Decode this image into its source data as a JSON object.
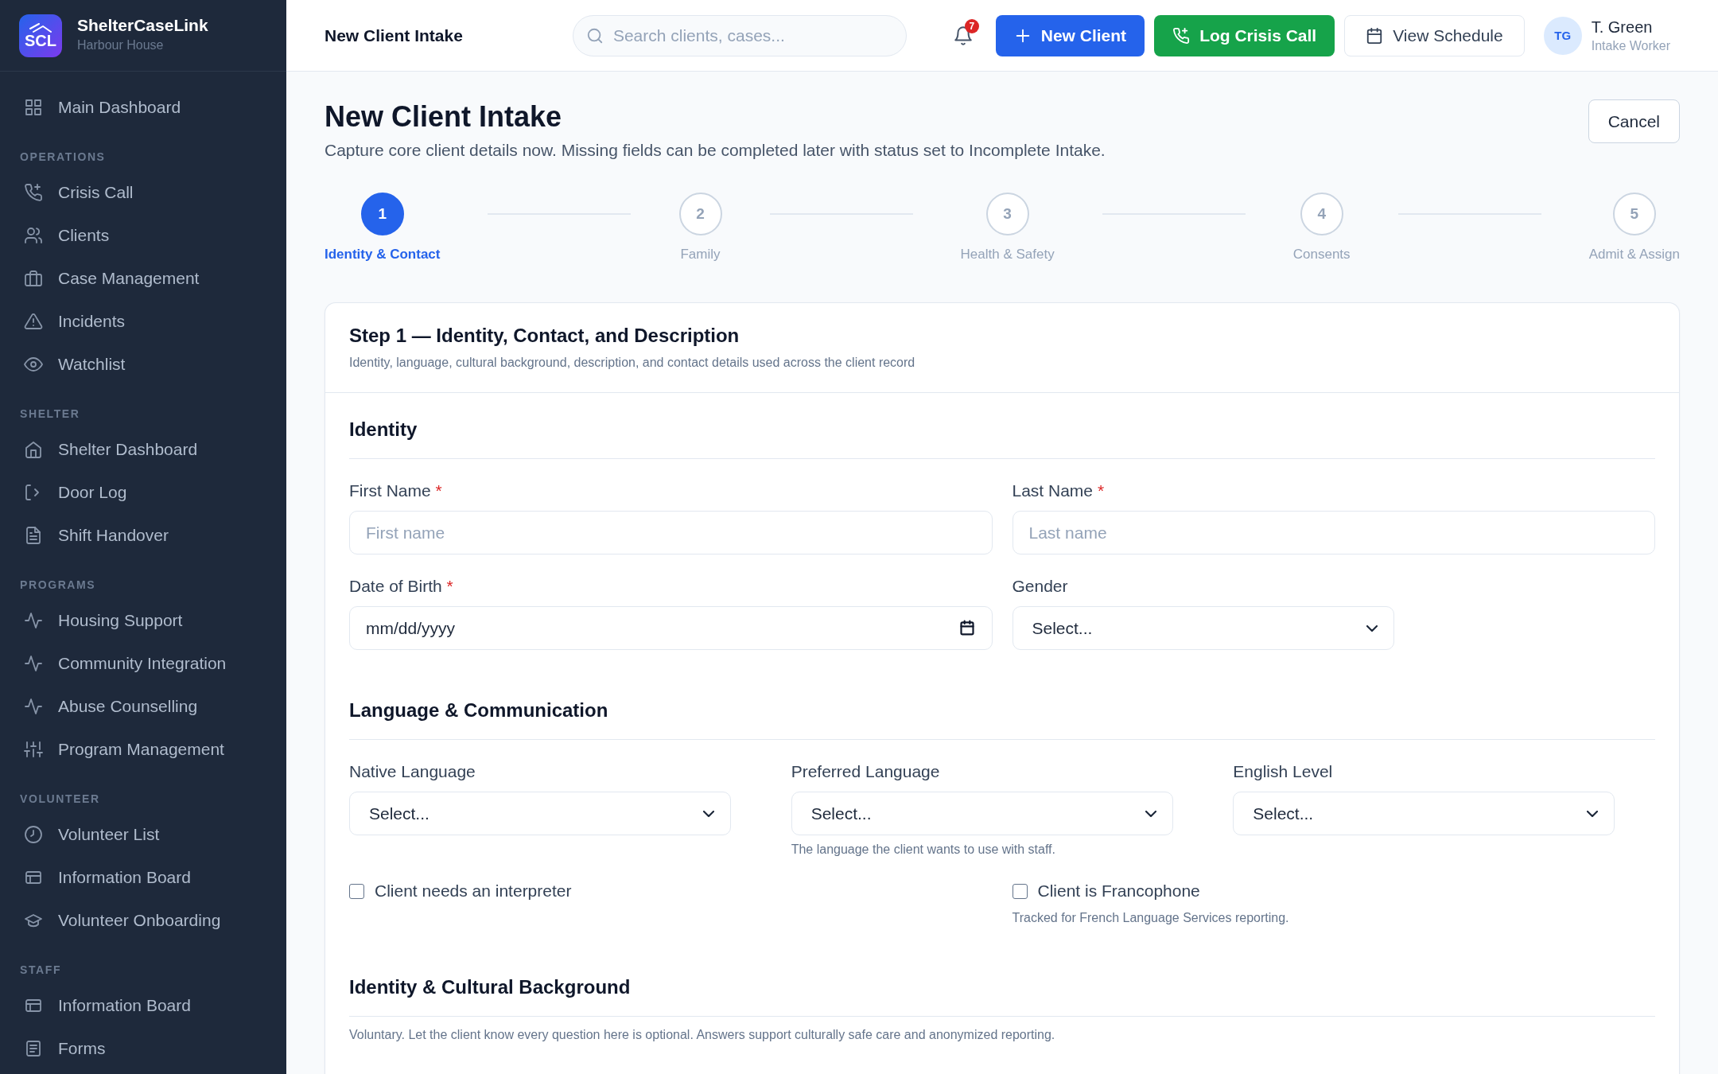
{
  "sidebar": {
    "logo_text": "SCL",
    "app_name": "ShelterCaseLink",
    "subtitle": "Harbour House",
    "sections": [
      {
        "items": [
          {
            "label": "Main Dashboard",
            "selected": false
          }
        ]
      },
      {
        "heading": "OPERATIONS",
        "items": [
          {
            "label": "Crisis Call",
            "selected": false
          },
          {
            "label": "Clients",
            "selected": false
          },
          {
            "label": "Case Management",
            "selected": false
          },
          {
            "label": "Incidents",
            "selected": false
          },
          {
            "label": "Watchlist",
            "selected": false
          }
        ]
      },
      {
        "heading": "SHELTER",
        "items": [
          {
            "label": "Shelter Dashboard",
            "selected": false
          },
          {
            "label": "Door Log",
            "selected": false
          },
          {
            "label": "Shift Handover",
            "selected": false
          }
        ]
      },
      {
        "heading": "PROGRAMS",
        "items": [
          {
            "label": "Housing Support",
            "selected": false
          },
          {
            "label": "Community Integration",
            "selected": false
          },
          {
            "label": "Abuse Counselling",
            "selected": false
          },
          {
            "label": "Program Management",
            "selected": false
          }
        ]
      },
      {
        "heading": "VOLUNTEER",
        "items": [
          {
            "label": "Volunteer List",
            "selected": false
          },
          {
            "label": "Information Board",
            "selected": false
          },
          {
            "label": "Volunteer Onboarding",
            "selected": false
          }
        ]
      },
      {
        "heading": "STAFF",
        "items": [
          {
            "label": "Information Board",
            "selected": false
          },
          {
            "label": "Forms",
            "selected": false
          }
        ]
      }
    ]
  },
  "topbar": {
    "title": "New Client Intake",
    "search": {
      "placeholder": "Search clients, cases..."
    },
    "notification_count": "7",
    "buttons": [
      {
        "label": "New Client",
        "kind": "primary"
      },
      {
        "label": "Log Crisis Call",
        "kind": "success"
      },
      {
        "label": "View Schedule",
        "kind": "secondary"
      }
    ],
    "user": {
      "initials": "TG",
      "name": "T. Green",
      "role": "Intake Worker"
    }
  },
  "page": {
    "title": "New Client Intake",
    "subtitle": "Capture core client details now. Missing fields can be completed later with status set to Incomplete Intake.",
    "cancel_button": "Cancel"
  },
  "steps": [
    {
      "number": "1",
      "label": "Identity & Contact",
      "selected": true
    },
    {
      "number": "2",
      "label": "Family",
      "selected": false
    },
    {
      "number": "3",
      "label": "Health & Safety",
      "selected": false
    },
    {
      "number": "4",
      "label": "Consents",
      "selected": false
    },
    {
      "number": "5",
      "label": "Admit & Assign",
      "selected": false
    }
  ],
  "form_card": {
    "title": "Step 1 — Identity, Contact, and Description",
    "subtitle": "Identity, language, cultural background, description, and contact details used across the client record",
    "sections": [
      {
        "title": "Identity",
        "rows": [
          [
            {
              "kind": "text",
              "label": "First Name",
              "required_mark": "*",
              "placeholder": "First name"
            },
            {
              "kind": "text",
              "label": "Last Name",
              "required_mark": "*",
              "placeholder": "Last name"
            }
          ],
          [
            {
              "kind": "date",
              "label": "Date of Birth",
              "required_mark": "*",
              "placeholder": "mm/dd/yyyy"
            },
            {
              "kind": "select",
              "label": "Gender",
              "placeholder": "Select..."
            }
          ]
        ]
      },
      {
        "title": "Language & Communication",
        "rows": [
          [
            {
              "kind": "select",
              "label": "Native Language",
              "placeholder": "Select..."
            },
            {
              "kind": "select",
              "label": "Preferred Language",
              "placeholder": "Select...",
              "hint": "The language the client wants to use with staff."
            },
            {
              "kind": "select",
              "label": "English Level",
              "placeholder": "Select..."
            }
          ],
          [
            {
              "kind": "checkbox",
              "label": "Client needs an interpreter",
              "checked": false
            },
            {
              "kind": "checkbox",
              "label": "Client is Francophone",
              "checked": false,
              "hint": "Tracked for French Language Services reporting."
            }
          ]
        ]
      },
      {
        "title": "Identity & Cultural Background",
        "note": "Voluntary. Let the client know every question here is optional. Answers support culturally safe care and anonymized reporting."
      }
    ]
  }
}
